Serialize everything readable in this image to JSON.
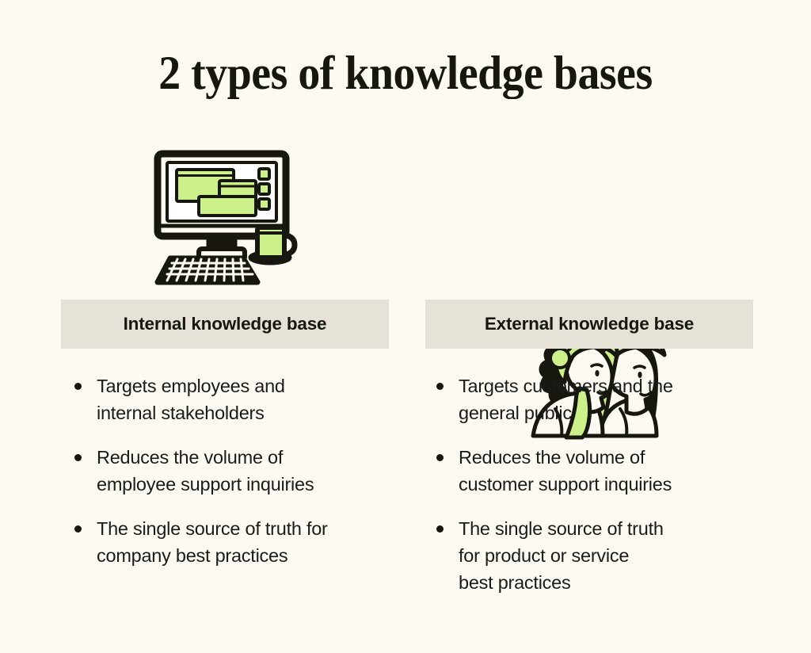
{
  "page": {
    "title": "2 types of knowledge bases",
    "background_color": "#FDF9F3",
    "accent_green": "#CCF08A",
    "ink_color": "#17160F",
    "bar_color": "#E6E2D7"
  },
  "columns": [
    {
      "id": "internal",
      "illustration": "desktop-computer-illustration",
      "header": "Internal knowledge base",
      "bullets": [
        "Targets employees and\ninternal stakeholders",
        "Reduces the volume of\nemployee support inquiries",
        "The single source of truth for\ncompany best practices"
      ]
    },
    {
      "id": "external",
      "illustration": "two-people-illustration",
      "header": "External knowledge base",
      "bullets": [
        "Targets customers and the\ngeneral public",
        "Reduces the volume of\ncustomer support inquiries",
        "The single source of truth\nfor product or service\nbest practices"
      ]
    }
  ]
}
